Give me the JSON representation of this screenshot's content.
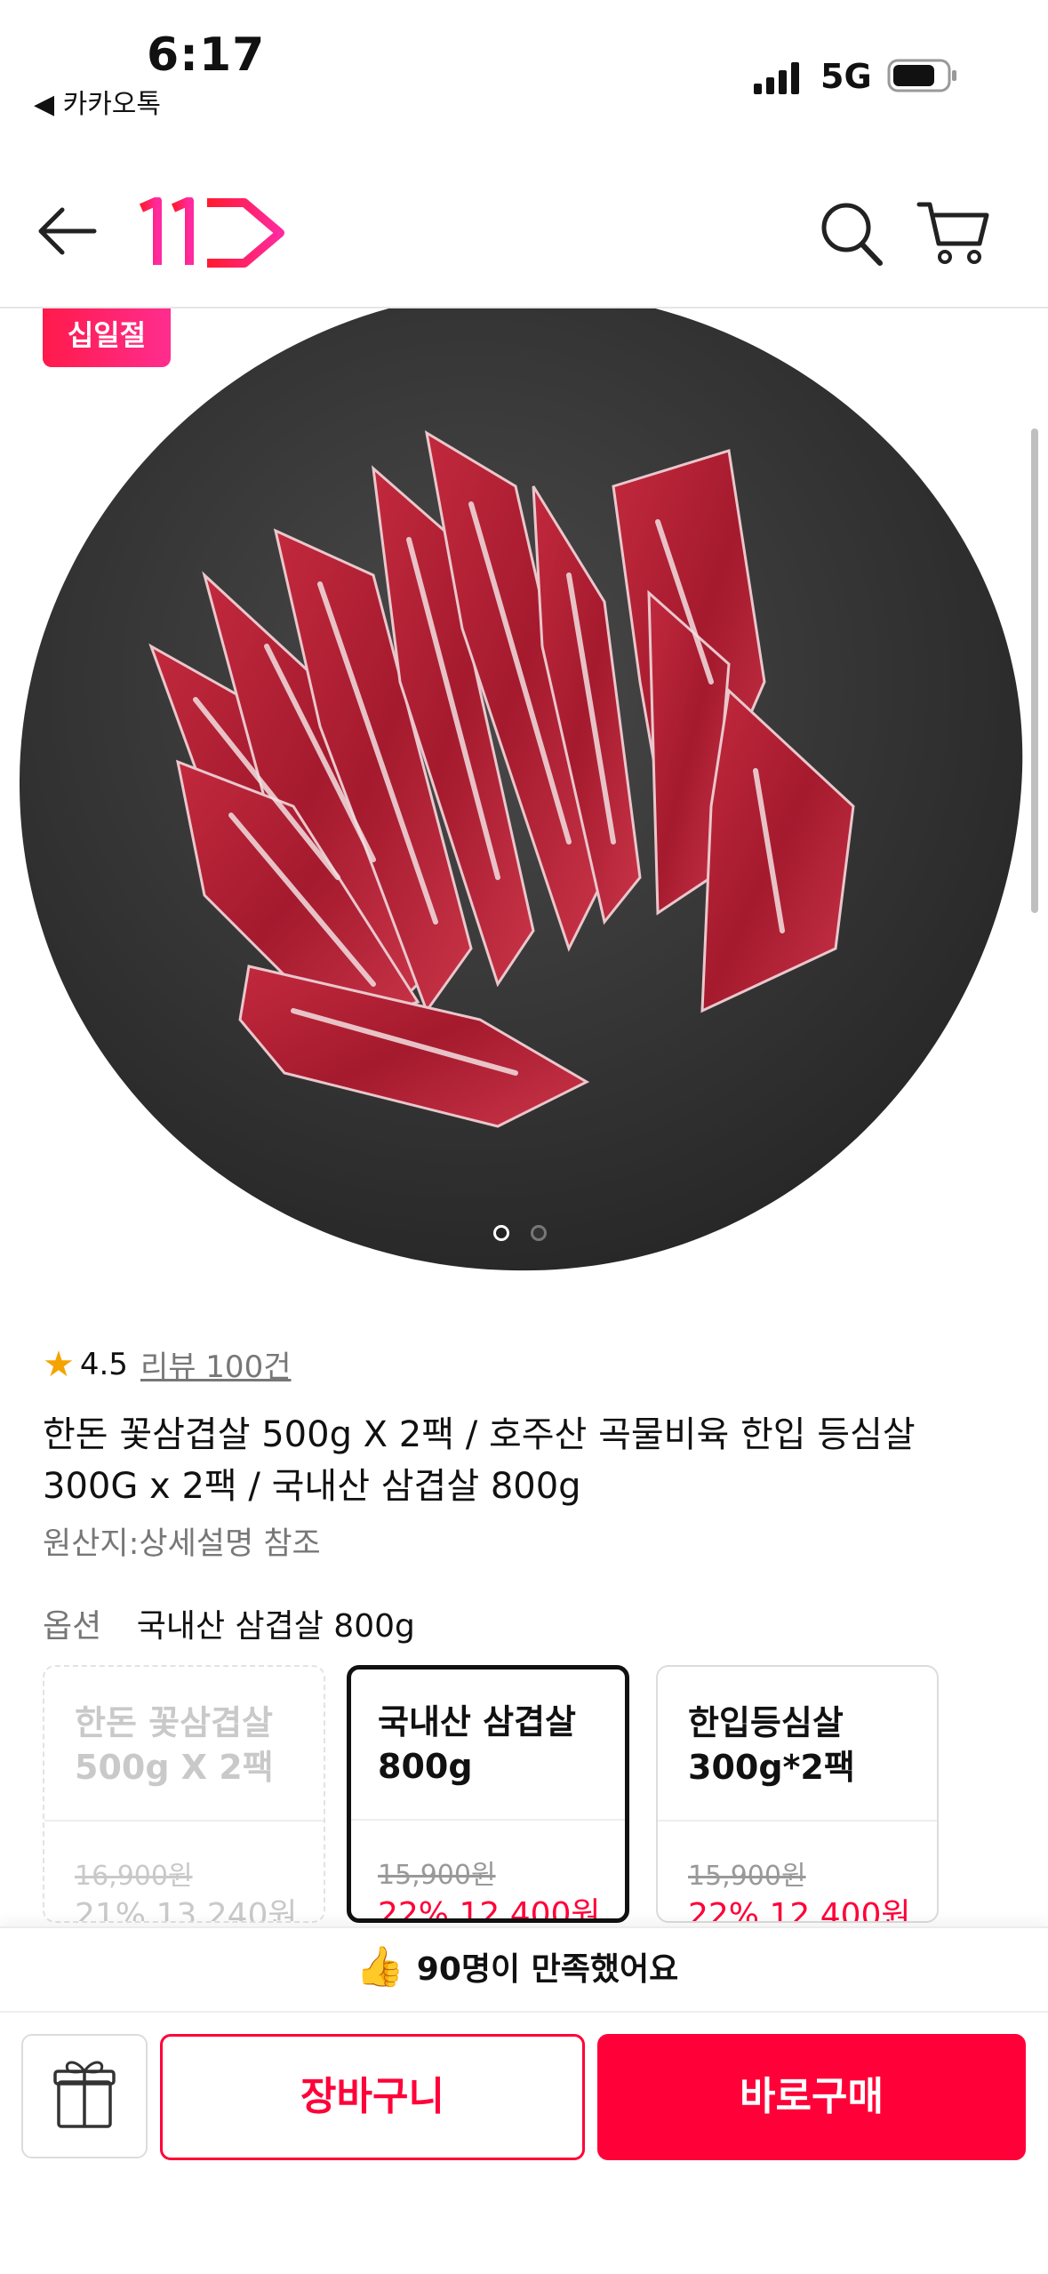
{
  "status_bar": {
    "time": "6:17",
    "back_app": "◀ 카카오톡",
    "network": "5G"
  },
  "header": {
    "logo_text": "11"
  },
  "product": {
    "badge": "십일절",
    "rating": "4.5",
    "review_label": "리뷰 100건",
    "title": "한돈 꽃삼겹살 500g X 2팩 / 호주산 곡물비육 한입 등심살 300G x 2팩 / 국내산 삼겹살 800g",
    "origin": "원산지:상세설명 참조",
    "image_pages": {
      "current": 1,
      "total": 2
    }
  },
  "options": {
    "label": "옵션",
    "selected": "국내산 삼겹살 800g",
    "cards": [
      {
        "name": "한돈 꽃삼겹살 500g X 2팩",
        "original_price": "16,900원",
        "sale": "21% 13,240원",
        "state": "disabled"
      },
      {
        "name": "국내산 삼겹살 800g",
        "original_price": "15,900원",
        "sale": "22% 12,400원",
        "state": "selected"
      },
      {
        "name": "한입등심살 300g*2팩",
        "original_price": "15,900원",
        "sale": "22% 12,400원",
        "state": "normal"
      }
    ]
  },
  "satisfaction": {
    "text": "90명이 만족했어요",
    "icon": "thumbs-up-icon"
  },
  "actions": {
    "cart_label": "장바구니",
    "buy_label": "바로구매",
    "gift_icon": "gift-icon"
  },
  "colors": {
    "accent": "#ff0038",
    "badge_start": "#ff1a4a",
    "badge_end": "#ff2d8f",
    "star": "#f5a300"
  }
}
